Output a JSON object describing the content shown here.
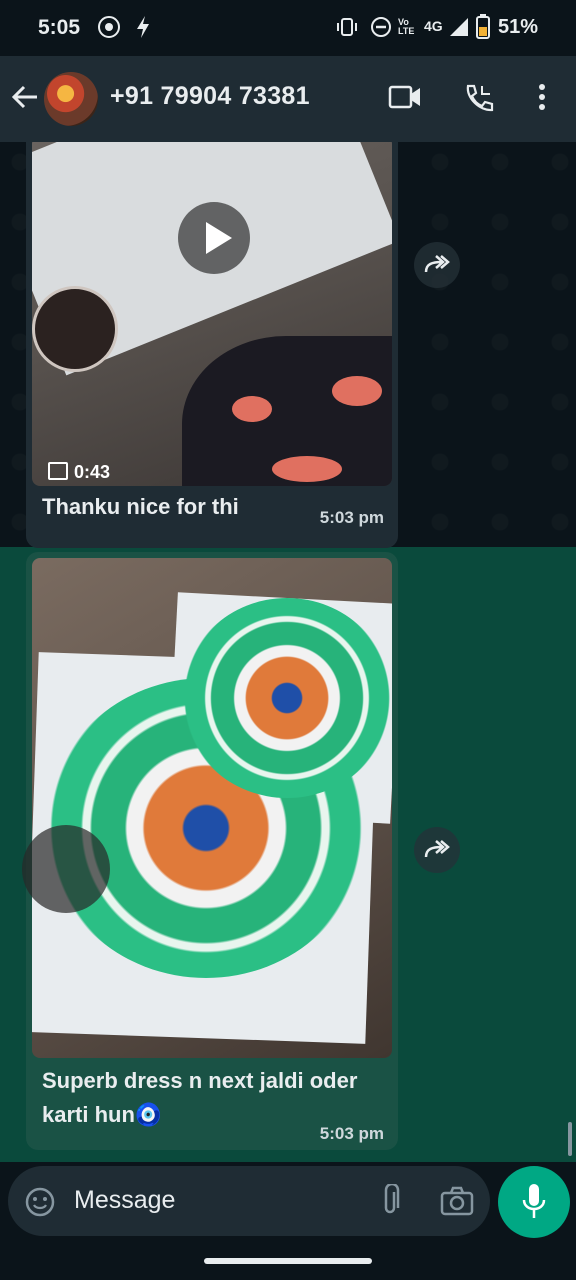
{
  "status_bar": {
    "time": "5:05",
    "network": "4G",
    "volte": "Vo LTE",
    "battery": "51%"
  },
  "header": {
    "contact": "+91 79904 73381"
  },
  "messages": [
    {
      "type": "video",
      "duration": "0:43",
      "caption": "Thanku nice for thi",
      "time": "5:03 pm"
    },
    {
      "type": "image",
      "caption_line1": "Superb dress n next jaldi oder",
      "caption_line2": "karti hun🧿",
      "time": "5:03 pm"
    }
  ],
  "input": {
    "placeholder": "Message"
  },
  "colors": {
    "accent": "#00a884",
    "bubble_incoming": "#1f2c34",
    "selected": "#0a4a3c"
  }
}
